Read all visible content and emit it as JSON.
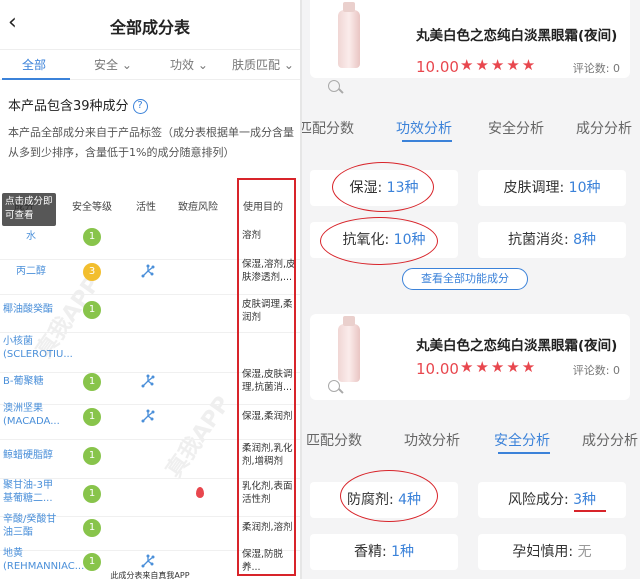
{
  "left": {
    "header": {
      "back": "‹",
      "title": "全部成分表"
    },
    "tabs": [
      "全部",
      "安全",
      "功效",
      "肤质匹配"
    ],
    "summary": "本产品包含39种成分",
    "help": "?",
    "note": "本产品全部成分来自于产品标签（成分表根据单一成分含量从多到少排序，含量低于1%的成分随意排列）",
    "tooltip": "点击成分即可查看",
    "columns": [
      "成分",
      "安全等级",
      "活性",
      "致痘风险",
      "使用目的"
    ],
    "rows": [
      {
        "name": "水",
        "level": "1",
        "levelColor": "#88c44b",
        "active": false,
        "acne": false,
        "use": "溶剂"
      },
      {
        "name": "丙二醇",
        "level": "3",
        "levelColor": "#f2be2e",
        "active": true,
        "acne": false,
        "use": "保湿,溶剂,皮肤渗透剂,..."
      },
      {
        "name": "椰油酸癸酯",
        "level": "1",
        "levelColor": "#88c44b",
        "active": false,
        "acne": false,
        "use": "皮肤调理,柔润剂"
      },
      {
        "name": "小核菌(SCLEROTIU...",
        "level": "",
        "levelColor": "",
        "active": false,
        "acne": false,
        "use": ""
      },
      {
        "name": "B-葡聚糖",
        "level": "1",
        "levelColor": "#88c44b",
        "active": true,
        "acne": false,
        "use": "保湿,皮肤调理,抗菌消..."
      },
      {
        "name": "澳洲坚果(MACADA...",
        "level": "1",
        "levelColor": "#88c44b",
        "active": true,
        "acne": false,
        "use": "保湿,柔润剂"
      },
      {
        "name": "鲸蜡硬脂醇",
        "level": "1",
        "levelColor": "#88c44b",
        "active": false,
        "acne": false,
        "use": "柔润剂,乳化剂,增稠剂"
      },
      {
        "name": "聚甘油-3甲基葡糖二...",
        "level": "1",
        "levelColor": "#88c44b",
        "active": false,
        "acne": true,
        "use": "乳化剂,表面活性剂"
      },
      {
        "name": "辛酸/癸酸甘油三酯",
        "level": "1",
        "levelColor": "#88c44b",
        "active": false,
        "acne": false,
        "use": "柔润剂,溶剂"
      },
      {
        "name": "地黄(REHMANNIAC...",
        "level": "1",
        "levelColor": "#88c44b",
        "active": true,
        "acne": false,
        "use": "保湿,防脱养..."
      }
    ],
    "footer": "此成分表来自真我APP"
  },
  "right": {
    "card1": {
      "product": "丸美白色之恋纯白淡黑眼霜(夜间)",
      "score": "10.00",
      "stars": "★★★★★",
      "reviews": "评论数: 0"
    },
    "tabs1": [
      "匹配分数",
      "功效分析",
      "安全分析",
      "成分分析"
    ],
    "efficacy": [
      {
        "label": "保湿: ",
        "value": "13种"
      },
      {
        "label": "皮肤调理: ",
        "value": "10种"
      },
      {
        "label": "抗氧化: ",
        "value": "10种"
      },
      {
        "label": "抗菌消炎: ",
        "value": "8种"
      }
    ],
    "viewAll": "查看全部功能成分",
    "card2": {
      "product": "丸美白色之恋纯白淡黑眼霜(夜间)",
      "score": "10.00",
      "stars": "★★★★★",
      "reviews": "评论数: 0"
    },
    "tabs2": [
      "匹配分数",
      "功效分析",
      "安全分析",
      "成分分析"
    ],
    "safety": [
      {
        "label": "防腐剂: ",
        "value": "4种"
      },
      {
        "label": "风险成分: ",
        "value": "3种"
      },
      {
        "label": "香精: ",
        "value": "1种"
      },
      {
        "label": "孕妇慎用: ",
        "value": "无"
      }
    ]
  },
  "colors": {
    "accent": "#3b82d9",
    "star": "#e8474e",
    "annotation": "#d8242a",
    "safe": "#88c44b",
    "caution": "#f2be2e"
  }
}
